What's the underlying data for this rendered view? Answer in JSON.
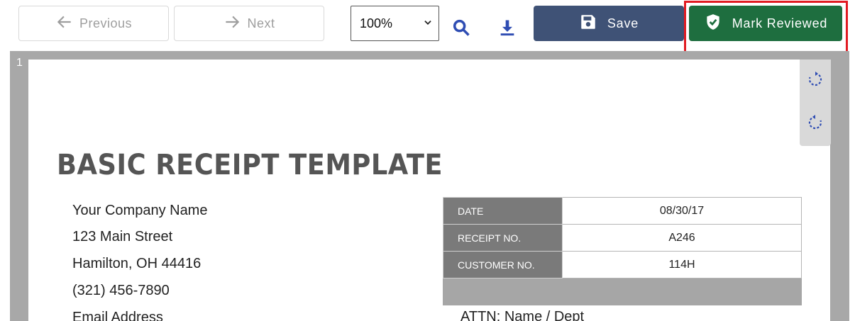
{
  "toolbar": {
    "previous_label": "Previous",
    "next_label": "Next",
    "zoom_value": "100%",
    "save_label": "Save",
    "mark_reviewed_label": "Mark Reviewed",
    "icons": {
      "previous": "arrow-left-icon",
      "next": "arrow-right-icon",
      "zoom_dropdown": "chevron-down-icon",
      "search": "search-icon",
      "download": "download-icon",
      "save": "floppy-disk-icon",
      "mark_reviewed": "shield-check-icon"
    }
  },
  "annotation": {
    "highlight_color": "#e11b22",
    "arrow": "up-arrow-icon"
  },
  "viewer": {
    "page_number": "1",
    "rotate_clockwise_icon": "rotate-clockwise-icon",
    "rotate_counterclockwise_icon": "rotate-counterclockwise-icon"
  },
  "document": {
    "title": "BASIC RECEIPT TEMPLATE",
    "company": {
      "name": "Your Company Name",
      "street": "123 Main Street",
      "city": "Hamilton, OH  44416",
      "phone": "(321) 456-7890",
      "email": "Email Address"
    },
    "info": [
      {
        "label": "DATE",
        "value": "08/30/17"
      },
      {
        "label": "RECEIPT NO.",
        "value": "A246"
      },
      {
        "label": "CUSTOMER NO.",
        "value": "114H"
      }
    ],
    "attn": "ATTN: Name / Dept"
  },
  "colors": {
    "save_button": "#3f5276",
    "mark_reviewed_button": "#1e6e3f",
    "link_icon": "#2f4db3"
  }
}
